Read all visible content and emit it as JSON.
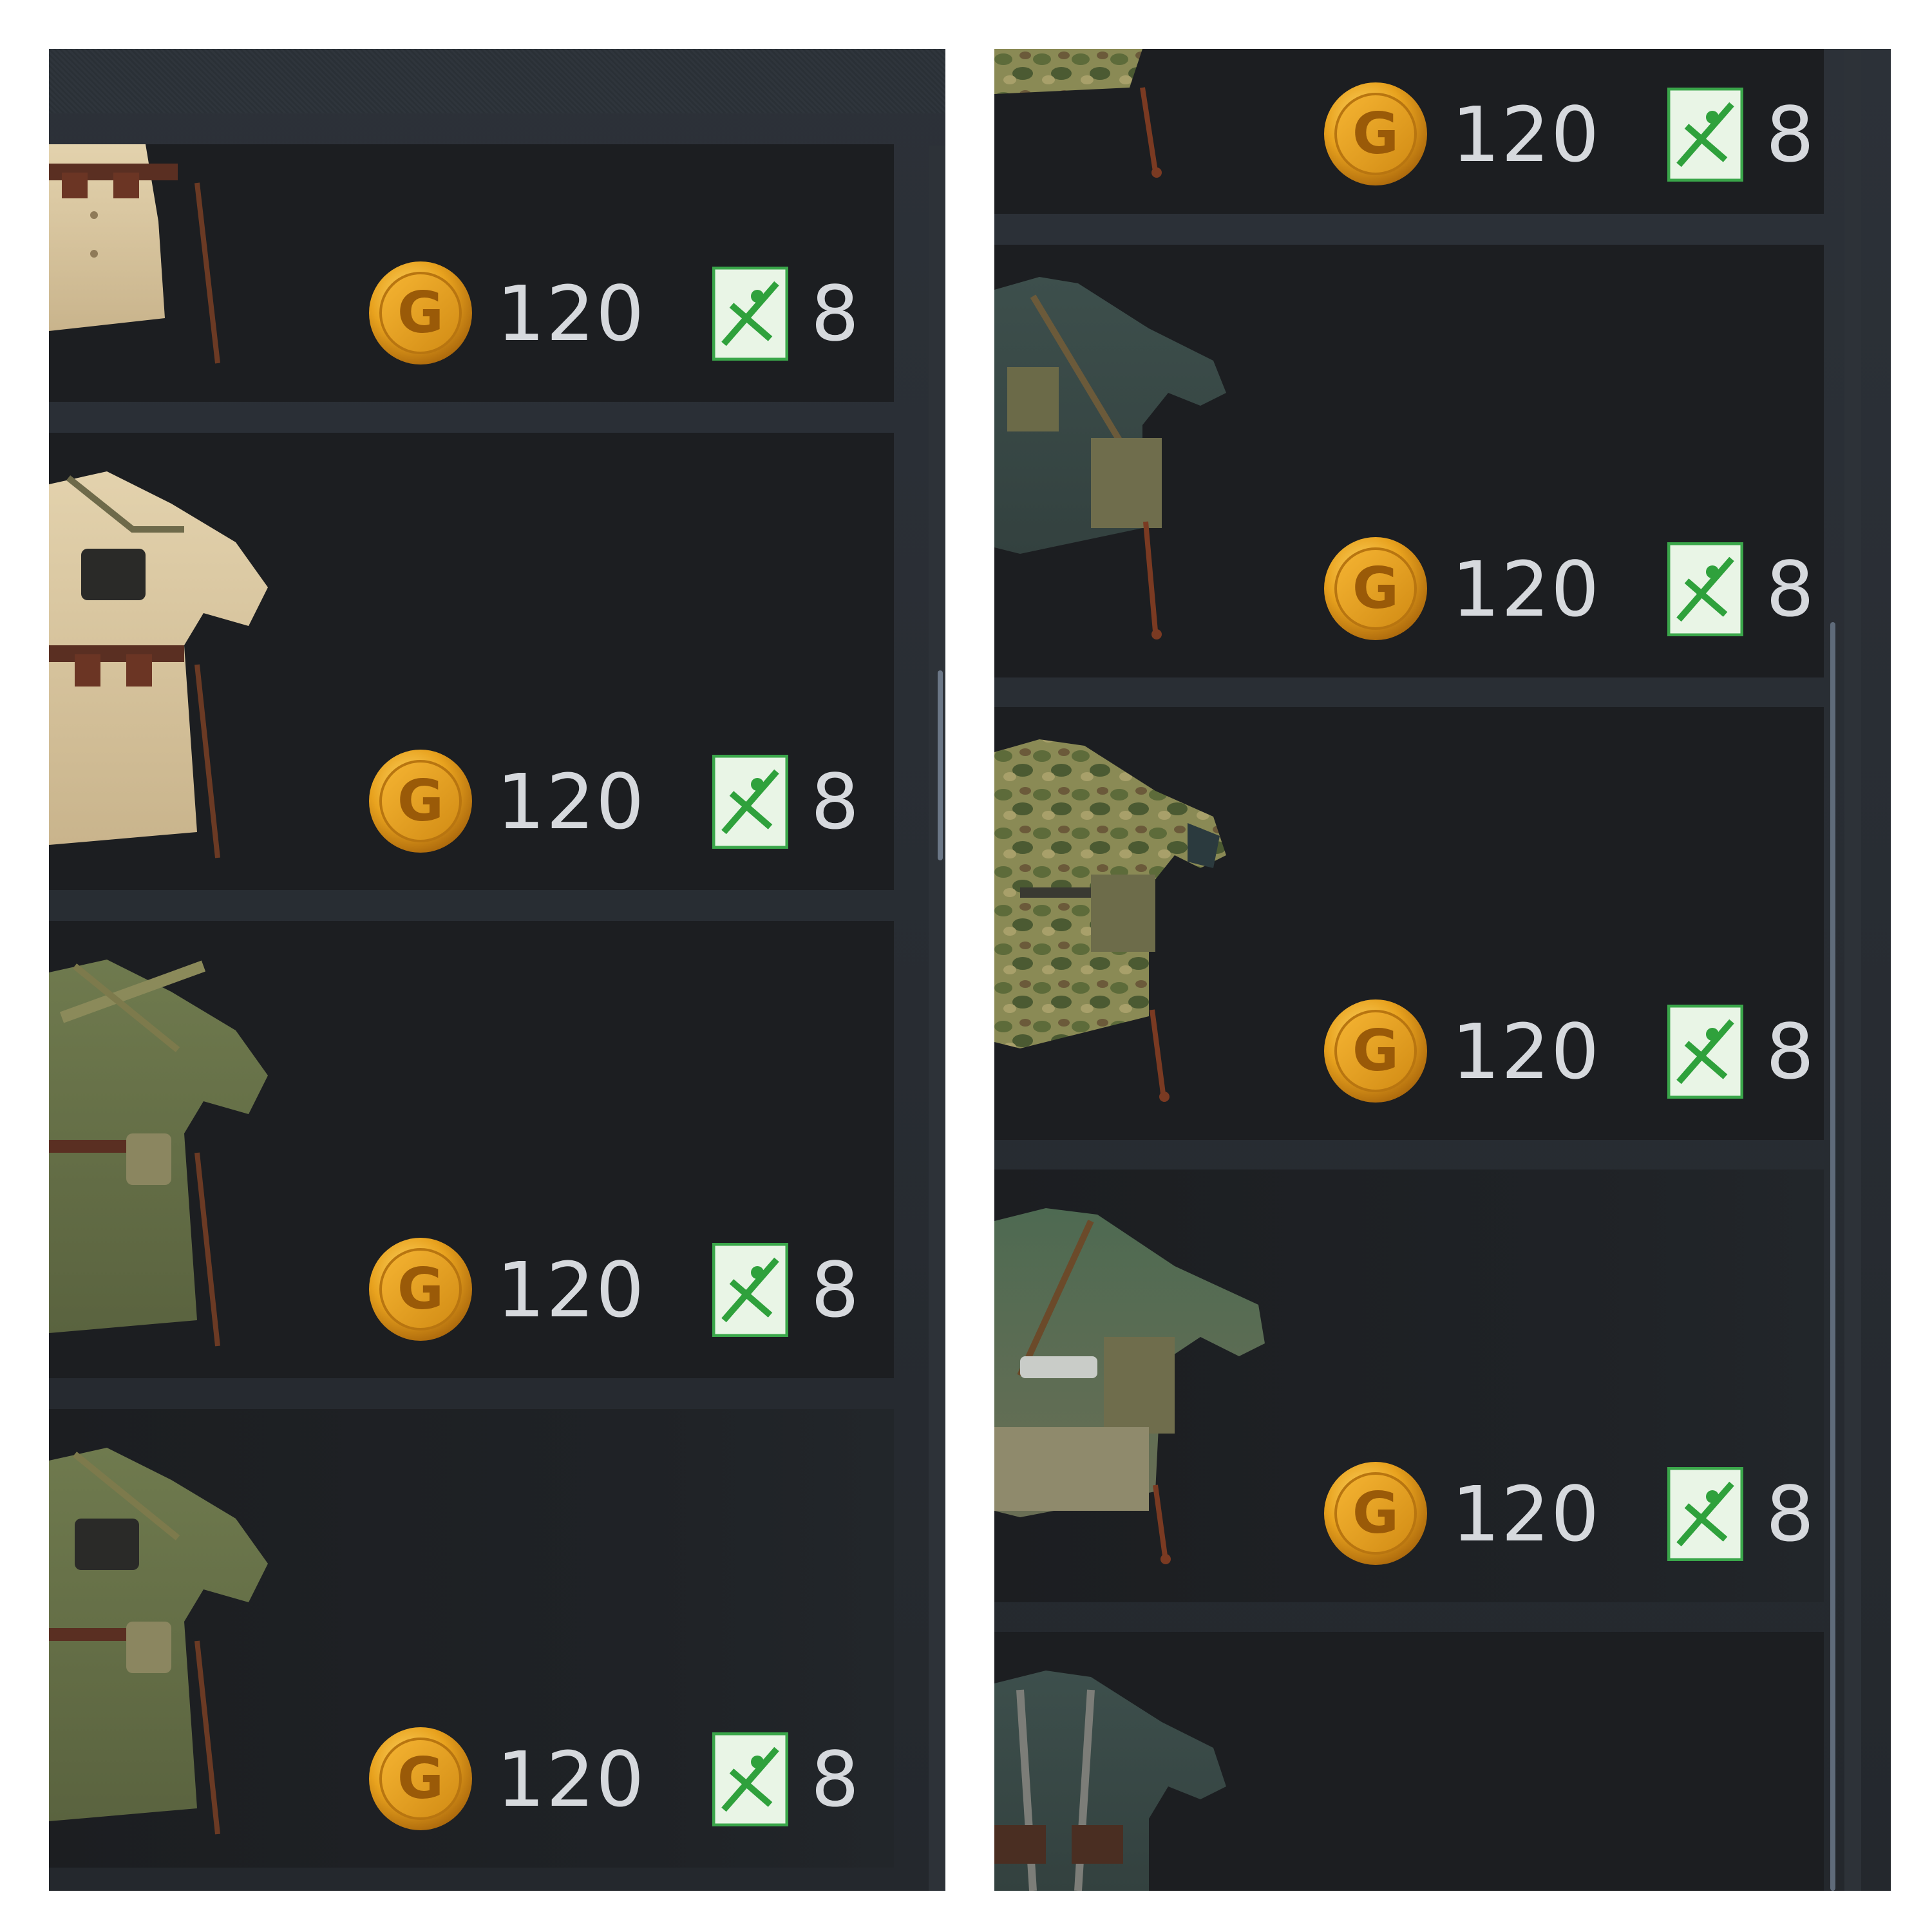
{
  "colors": {
    "panel_bg": "#2c3138",
    "row_bg": "#1c1e21",
    "price_text": "#d6d9dd",
    "coin_gold": "#e8a21e",
    "ticket_green": "#2fa13c"
  },
  "icons": {
    "currency": "gold-coin-icon",
    "ticket": "order-ticket-icon"
  },
  "left_panel": {
    "items": [
      {
        "uniform": "tan-coat",
        "gold_price": "120",
        "ticket_price": "8"
      },
      {
        "uniform": "tan-coat-binoculars",
        "gold_price": "120",
        "ticket_price": "8"
      },
      {
        "uniform": "olive-coat",
        "gold_price": "120",
        "ticket_price": "8"
      },
      {
        "uniform": "olive-coat-binoculars",
        "gold_price": "120",
        "ticket_price": "8"
      }
    ]
  },
  "right_panel": {
    "items": [
      {
        "uniform": "camo-smock",
        "gold_price": "120",
        "ticket_price": "8"
      },
      {
        "uniform": "field-grey-tunic",
        "gold_price": "120",
        "ticket_price": "8"
      },
      {
        "uniform": "camo-tunic",
        "gold_price": "120",
        "ticket_price": "8"
      },
      {
        "uniform": "green-tunic-belt",
        "gold_price": "120",
        "ticket_price": "8"
      },
      {
        "uniform": "grey-tunic-webbing"
      }
    ]
  }
}
